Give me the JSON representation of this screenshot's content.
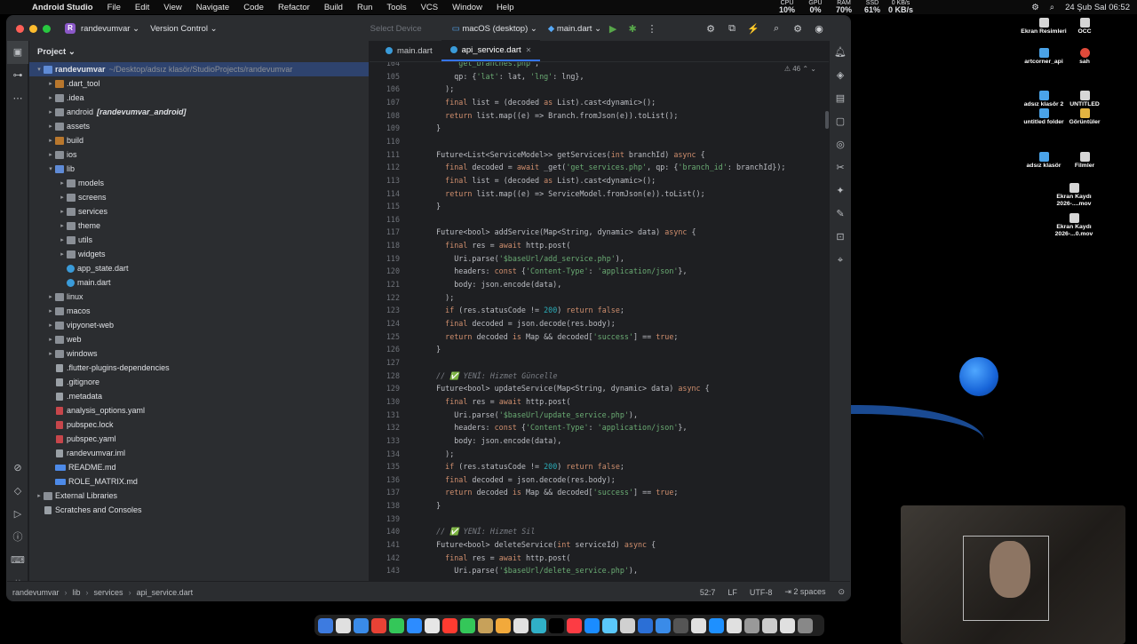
{
  "menubar": {
    "app": "Android Studio",
    "items": [
      "File",
      "Edit",
      "View",
      "Navigate",
      "Code",
      "Refactor",
      "Build",
      "Run",
      "Tools",
      "VCS",
      "Window",
      "Help"
    ],
    "stats": [
      {
        "label": "CPU",
        "value": "10%"
      },
      {
        "label": "GPU",
        "value": "0%"
      },
      {
        "label": "RAM",
        "value": "70%"
      },
      {
        "label": "SSD",
        "value": "61%"
      },
      {
        "label": "0 KB/s",
        "value": "0 KB/s"
      }
    ],
    "datetime": "24 Şub Sal  06:52"
  },
  "titlebar": {
    "project_badge": "R",
    "project": "randevumvar",
    "vcs": "Version Control",
    "device": "Select Device",
    "target": "macOS (desktop)",
    "run_config": "main.dart"
  },
  "project_panel": {
    "title": "Project",
    "root_name": "randevumvar",
    "root_path": "~/Desktop/adsız klasör/StudioProjects/randevumvar",
    "tree": [
      {
        "depth": 1,
        "arrow": "▸",
        "icon": "ofolder",
        "label": "dart_tool",
        "prefix": "."
      },
      {
        "depth": 1,
        "arrow": "▸",
        "icon": "folder",
        "label": "idea",
        "prefix": "."
      },
      {
        "depth": 1,
        "arrow": "▸",
        "icon": "folder",
        "label": "android",
        "extra": "[randevumvar_android]"
      },
      {
        "depth": 1,
        "arrow": "▸",
        "icon": "folder",
        "label": "assets"
      },
      {
        "depth": 1,
        "arrow": "▸",
        "icon": "ofolder",
        "label": "build"
      },
      {
        "depth": 1,
        "arrow": "▸",
        "icon": "folder",
        "label": "ios"
      },
      {
        "depth": 1,
        "arrow": "▾",
        "icon": "bfolder",
        "label": "lib"
      },
      {
        "depth": 2,
        "arrow": "▸",
        "icon": "folder",
        "label": "models"
      },
      {
        "depth": 2,
        "arrow": "▸",
        "icon": "folder",
        "label": "screens"
      },
      {
        "depth": 2,
        "arrow": "▸",
        "icon": "folder",
        "label": "services"
      },
      {
        "depth": 2,
        "arrow": "▸",
        "icon": "folder",
        "label": "theme"
      },
      {
        "depth": 2,
        "arrow": "▸",
        "icon": "folder",
        "label": "utils"
      },
      {
        "depth": 2,
        "arrow": "▸",
        "icon": "folder",
        "label": "widgets"
      },
      {
        "depth": 2,
        "arrow": "",
        "icon": "dart",
        "label": "app_state.dart"
      },
      {
        "depth": 2,
        "arrow": "",
        "icon": "dart",
        "label": "main.dart"
      },
      {
        "depth": 1,
        "arrow": "▸",
        "icon": "folder",
        "label": "linux"
      },
      {
        "depth": 1,
        "arrow": "▸",
        "icon": "folder",
        "label": "macos"
      },
      {
        "depth": 1,
        "arrow": "▸",
        "icon": "folder",
        "label": "vipyonet-web"
      },
      {
        "depth": 1,
        "arrow": "▸",
        "icon": "folder",
        "label": "web"
      },
      {
        "depth": 1,
        "arrow": "▸",
        "icon": "folder",
        "label": "windows"
      },
      {
        "depth": 1,
        "arrow": "",
        "icon": "file",
        "label": ".flutter-plugins-dependencies"
      },
      {
        "depth": 1,
        "arrow": "",
        "icon": "file",
        "label": ".gitignore"
      },
      {
        "depth": 1,
        "arrow": "",
        "icon": "file",
        "label": ".metadata"
      },
      {
        "depth": 1,
        "arrow": "",
        "icon": "yaml",
        "label": "analysis_options.yaml"
      },
      {
        "depth": 1,
        "arrow": "",
        "icon": "yaml",
        "label": "pubspec.lock"
      },
      {
        "depth": 1,
        "arrow": "",
        "icon": "yaml",
        "label": "pubspec.yaml"
      },
      {
        "depth": 1,
        "arrow": "",
        "icon": "file",
        "label": "randevumvar.iml"
      },
      {
        "depth": 1,
        "arrow": "",
        "icon": "md",
        "label": "README.md"
      },
      {
        "depth": 1,
        "arrow": "",
        "icon": "md",
        "label": "ROLE_MATRIX.md"
      },
      {
        "depth": 0,
        "arrow": "▸",
        "icon": "folder",
        "label": "External Libraries"
      },
      {
        "depth": 0,
        "arrow": "",
        "icon": "file",
        "label": "Scratches and Consoles"
      }
    ]
  },
  "editor": {
    "tabs": [
      {
        "label": "main.dart",
        "active": false
      },
      {
        "label": "api_service.dart",
        "active": true
      }
    ],
    "warnings": "46",
    "lines": [
      {
        "n": "104",
        "t": "      'get_branches.php',"
      },
      {
        "n": "105",
        "t": "      qp: {'lat': lat, 'lng': lng},"
      },
      {
        "n": "106",
        "t": "    );"
      },
      {
        "n": "107",
        "t": "    final list = (decoded as List).cast<dynamic>();"
      },
      {
        "n": "108",
        "t": "    return list.map((e) => Branch.fromJson(e)).toList();"
      },
      {
        "n": "109",
        "t": "  }"
      },
      {
        "n": "110",
        "t": ""
      },
      {
        "n": "111",
        "t": "  Future<List<ServiceModel>> getServices(int branchId) async {"
      },
      {
        "n": "112",
        "t": "    final decoded = await _get('get_services.php', qp: {'branch_id': branchId});"
      },
      {
        "n": "113",
        "t": "    final list = (decoded as List).cast<dynamic>();"
      },
      {
        "n": "114",
        "t": "    return list.map((e) => ServiceModel.fromJson(e)).toList();"
      },
      {
        "n": "115",
        "t": "  }"
      },
      {
        "n": "116",
        "t": ""
      },
      {
        "n": "117",
        "t": "  Future<bool> addService(Map<String, dynamic> data) async {"
      },
      {
        "n": "118",
        "t": "    final res = await http.post("
      },
      {
        "n": "119",
        "t": "      Uri.parse('$baseUrl/add_service.php'),"
      },
      {
        "n": "120",
        "t": "      headers: const {'Content-Type': 'application/json'},"
      },
      {
        "n": "121",
        "t": "      body: json.encode(data),"
      },
      {
        "n": "122",
        "t": "    );"
      },
      {
        "n": "123",
        "t": "    if (res.statusCode != 200) return false;"
      },
      {
        "n": "124",
        "t": "    final decoded = json.decode(res.body);"
      },
      {
        "n": "125",
        "t": "    return decoded is Map && decoded['success'] == true;"
      },
      {
        "n": "126",
        "t": "  }"
      },
      {
        "n": "127",
        "t": ""
      },
      {
        "n": "128",
        "t": "  // ✅ YENİ: Hizmet Güncelle"
      },
      {
        "n": "129",
        "t": "  Future<bool> updateService(Map<String, dynamic> data) async {"
      },
      {
        "n": "130",
        "t": "    final res = await http.post("
      },
      {
        "n": "131",
        "t": "      Uri.parse('$baseUrl/update_service.php'),"
      },
      {
        "n": "132",
        "t": "      headers: const {'Content-Type': 'application/json'},"
      },
      {
        "n": "133",
        "t": "      body: json.encode(data),"
      },
      {
        "n": "134",
        "t": "    );"
      },
      {
        "n": "135",
        "t": "    if (res.statusCode != 200) return false;"
      },
      {
        "n": "136",
        "t": "    final decoded = json.decode(res.body);"
      },
      {
        "n": "137",
        "t": "    return decoded is Map && decoded['success'] == true;"
      },
      {
        "n": "138",
        "t": "  }"
      },
      {
        "n": "139",
        "t": ""
      },
      {
        "n": "140",
        "t": "  // ✅ YENİ: Hizmet Sil"
      },
      {
        "n": "141",
        "t": "  Future<bool> deleteService(int serviceId) async {"
      },
      {
        "n": "142",
        "t": "    final res = await http.post("
      },
      {
        "n": "143",
        "t": "      Uri.parse('$baseUrl/delete_service.php'),"
      }
    ]
  },
  "statusbar": {
    "crumbs": [
      "randevumvar",
      "lib",
      "services",
      "api_service.dart"
    ],
    "position": "52:7",
    "line_sep": "LF",
    "encoding": "UTF-8",
    "indent": "2 spaces"
  },
  "desktop": {
    "icons": [
      {
        "label": "Ekran Resimleri",
        "style": "white"
      },
      {
        "label": "OCC",
        "style": "white"
      },
      {
        "label": "artcorner_api",
        "style": "blue"
      },
      {
        "label": "sah",
        "style": "red"
      },
      {
        "label": "adsız klasör 2",
        "style": "blue"
      },
      {
        "label": "UNTITLED",
        "style": "white"
      },
      {
        "label": "untitled folder",
        "style": "blue"
      },
      {
        "label": "Görüntüler",
        "style": "yellow"
      },
      {
        "label": "adsız klasör",
        "style": "blue"
      },
      {
        "label": "Filmler",
        "style": "white"
      },
      {
        "label": "Ekran Kaydı 2026-....mov",
        "style": "white"
      },
      {
        "label": "Ekran Kaydı 2026-...0.mov",
        "style": "white"
      }
    ]
  },
  "colors": {
    "accent": "#3574f0",
    "keyword": "#cf8e6d",
    "string": "#6aab73",
    "number": "#2aacb8",
    "comment": "#7a7e85"
  }
}
